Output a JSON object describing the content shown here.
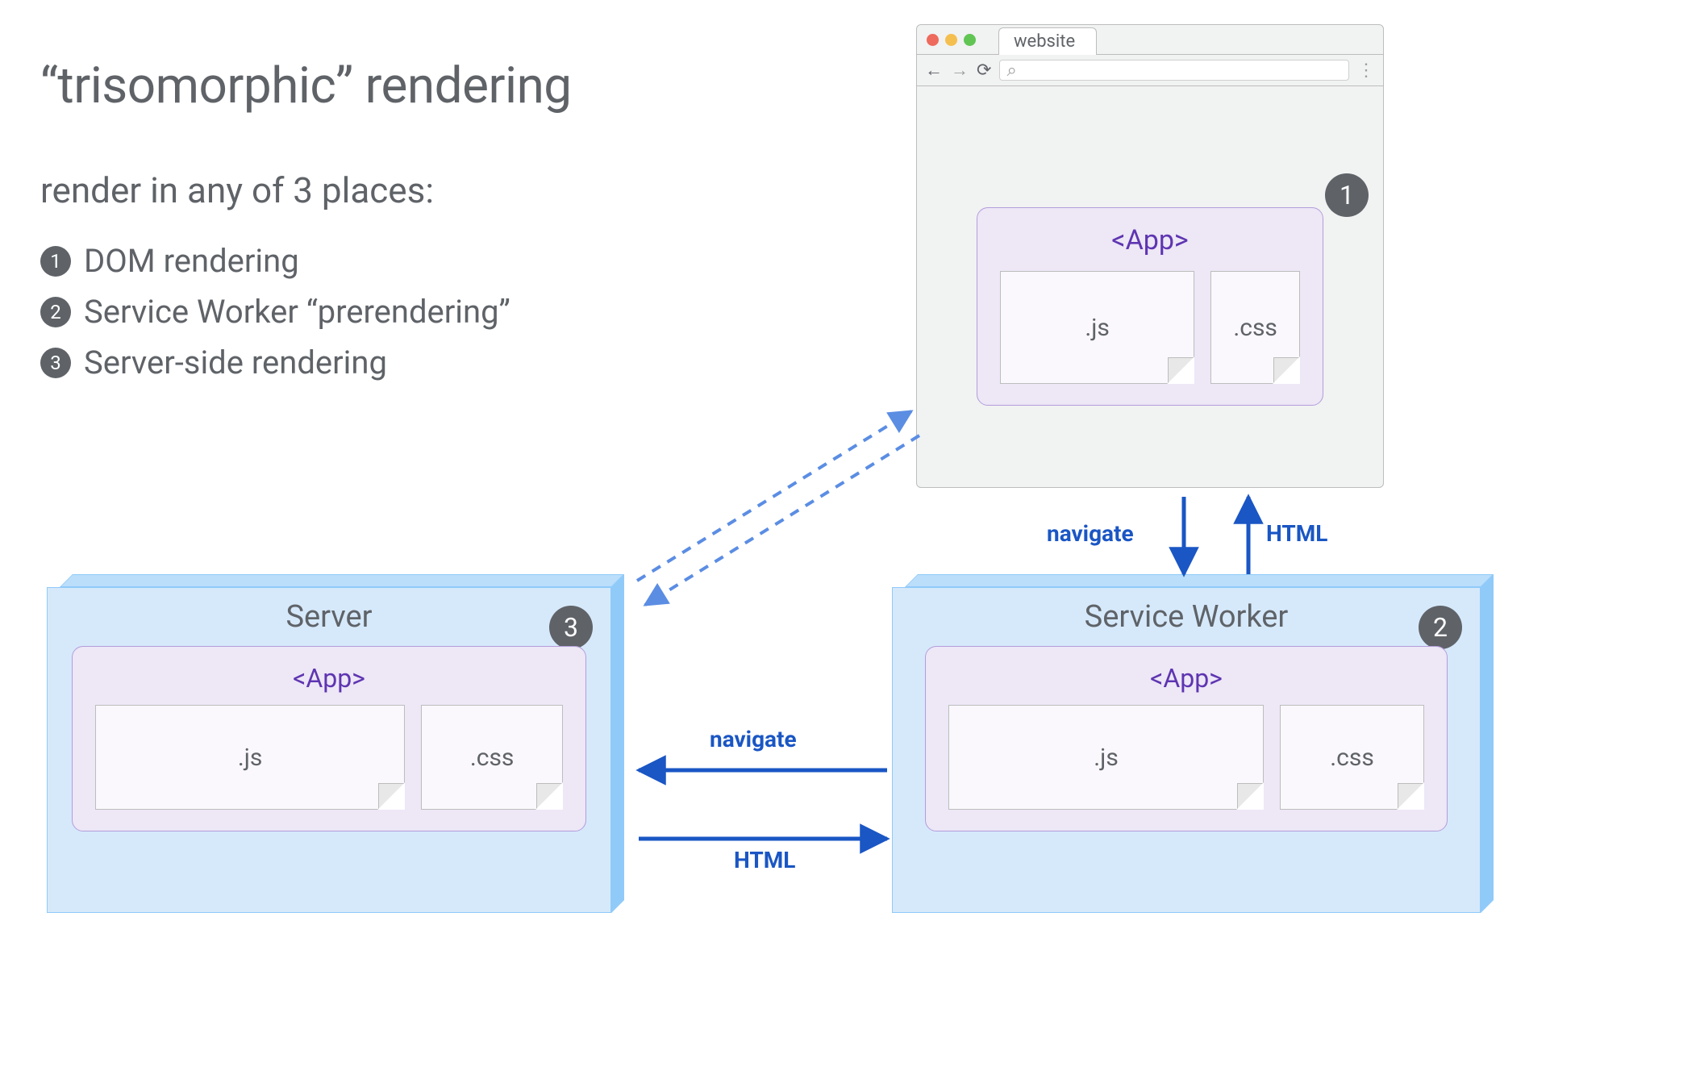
{
  "title": "“trisomorphic” rendering",
  "subtitle": "render in any of 3 places:",
  "items": [
    {
      "n": "1",
      "label": "DOM rendering"
    },
    {
      "n": "2",
      "label": "Service Worker “prerendering”"
    },
    {
      "n": "3",
      "label": "Server-side rendering"
    }
  ],
  "browser": {
    "tab": "website",
    "search_icon": "⌕",
    "back": "←",
    "forward": "→",
    "reload": "⟳",
    "menu": "⋮",
    "badge": "1",
    "app_label": "<App>",
    "js": ".js",
    "css": ".css"
  },
  "server": {
    "title": "Server",
    "badge": "3",
    "app_label": "<App>",
    "js": ".js",
    "css": ".css"
  },
  "sw": {
    "title": "Service Worker",
    "badge": "2",
    "app_label": "<App>",
    "js": ".js",
    "css": ".css"
  },
  "arrows": {
    "browser_to_sw": "navigate",
    "sw_to_browser": "HTML",
    "sw_to_server": "navigate",
    "server_to_sw": "HTML"
  }
}
